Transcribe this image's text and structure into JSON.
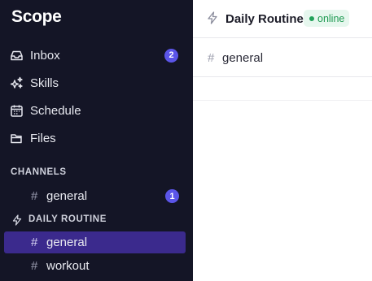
{
  "app": {
    "name": "Scope"
  },
  "sidebar": {
    "nav": [
      {
        "label": "Inbox",
        "icon": "inbox-icon",
        "badge": "2"
      },
      {
        "label": "Skills",
        "icon": "sparkles-icon"
      },
      {
        "label": "Schedule",
        "icon": "calendar-icon"
      },
      {
        "label": "Files",
        "icon": "folder-icon"
      }
    ],
    "channels_header": "CHANNELS",
    "channels": [
      {
        "hash": "#",
        "label": "general",
        "badge": "1"
      }
    ],
    "routine_header": "DAILY ROUTINE",
    "routine_channels": [
      {
        "hash": "#",
        "label": "general",
        "active": true
      },
      {
        "hash": "#",
        "label": "workout",
        "active": false
      }
    ]
  },
  "main": {
    "header": {
      "title": "Daily Routine",
      "status": "online"
    },
    "channel": {
      "hash": "#",
      "label": "general"
    }
  },
  "colors": {
    "sidebar_bg": "#141526",
    "accent": "#5b55e8",
    "active_item": "#3b2a8d",
    "online": "#1f9a52"
  }
}
